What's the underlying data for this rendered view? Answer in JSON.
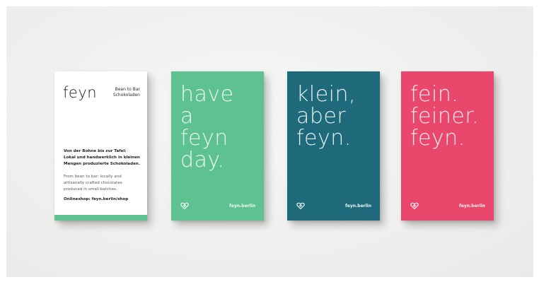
{
  "card1": {
    "logo": "feyn",
    "tagline": [
      "Bean to Bar",
      "Schokoladen"
    ],
    "blurb": [
      "Von der Bohne bis zur Tafel:",
      "Lokal und handwerklich in kleinen",
      "Mengen produzierte Schokoladen."
    ],
    "english": [
      "From bean to bar: locally and",
      "artisanally crafted chocolates",
      "produced in small batches."
    ],
    "shop": "Onlineshop: feyn.berlin/shop",
    "stripe_color": "#5ec190"
  },
  "card2": {
    "lines": [
      "have",
      "a",
      "feyn",
      "day."
    ],
    "url": "feyn.berlin",
    "icon": "heart-diamond-icon",
    "color": "#5ec190"
  },
  "card3": {
    "lines": [
      "klein,",
      "aber",
      "feyn."
    ],
    "url": "feyn.berlin",
    "icon": "heart-diamond-icon",
    "color": "#1e6a7a"
  },
  "card4": {
    "lines": [
      "fein.",
      "feiner.",
      "feyn."
    ],
    "url": "feyn.berlin",
    "icon": "heart-diamond-icon",
    "color": "#e9486c"
  }
}
